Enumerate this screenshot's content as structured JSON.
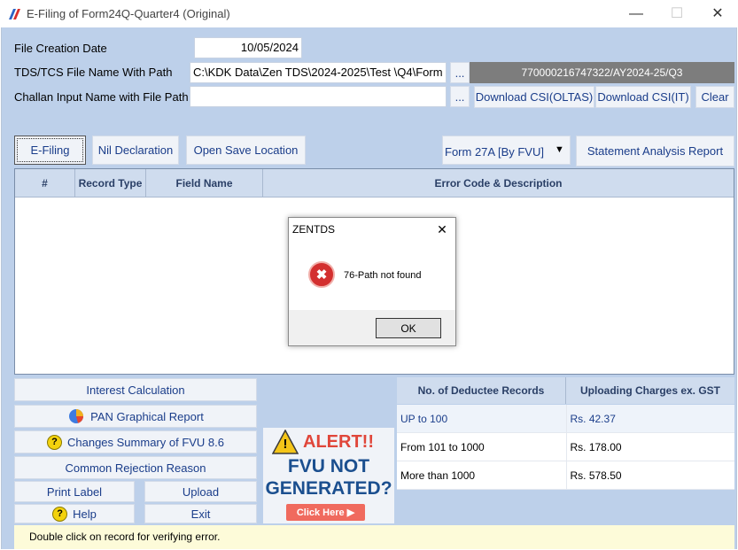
{
  "window": {
    "title": "E-Filing of Form24Q-Quarter4 (Original)",
    "minimize_glyph": "—",
    "maximize_glyph": "☐",
    "close_glyph": "✕"
  },
  "form": {
    "file_creation_label": "File Creation Date",
    "file_creation_value": "10/05/2024",
    "tds_file_label": "TDS/TCS File Name With Path",
    "tds_file_value": "C:\\KDK Data\\Zen TDS\\2024-2025\\Test         \\Q4\\Form",
    "browse_label": "...",
    "token_value": "770000216747322/AY2024-25/Q3",
    "challan_label": "Challan Input Name with File Path",
    "challan_value": "",
    "download_oltas": "Download CSI(OLTAS)",
    "download_it": "Download CSI(IT)",
    "clear": "Clear"
  },
  "toolbar": {
    "efiling": "E-Filing",
    "nil": "Nil Declaration",
    "open_save": "Open Save Location",
    "form_select": "Form 27A [By FVU]",
    "dropdown_glyph": "▼",
    "statement": "Statement Analysis Report"
  },
  "grid": {
    "columns": [
      "#",
      "Record Type",
      "Field Name",
      "Error Code & Description"
    ]
  },
  "dialog": {
    "title": "ZENTDS",
    "message": "76-Path not found",
    "ok": "OK",
    "close_glyph": "✕",
    "error_glyph": "✖"
  },
  "left_panel": {
    "interest": "Interest Calculation",
    "pan_graph": "PAN Graphical Report",
    "changes": "Changes Summary of FVU 8.6",
    "rejection": "Common Rejection Reason",
    "print_label": "Print Label",
    "upload": "Upload",
    "help": "Help",
    "exit": "Exit",
    "question_glyph": "?"
  },
  "rates": {
    "col1": "No. of Deductee Records",
    "col2": "Uploading Charges ex. GST",
    "rows": [
      {
        "range": "UP to 100",
        "charge": "Rs. 42.37"
      },
      {
        "range": "From 101 to 1000",
        "charge": "Rs. 178.00"
      },
      {
        "range": "More than 1000",
        "charge": "Rs. 578.50"
      }
    ]
  },
  "alert": {
    "title": "ALERT!!",
    "line1": "FVU NOT",
    "line2": "GENERATED?",
    "button": "Click Here ▶",
    "warning_glyph": "!"
  },
  "status": {
    "text": "Double click on record for verifying error."
  },
  "colors": {
    "accent": "#1a3d8a",
    "error_red": "#d32f2f",
    "alert_red": "#e0463a",
    "alert_blue": "#1b4f8f",
    "warning_yellow": "#f5c518"
  }
}
